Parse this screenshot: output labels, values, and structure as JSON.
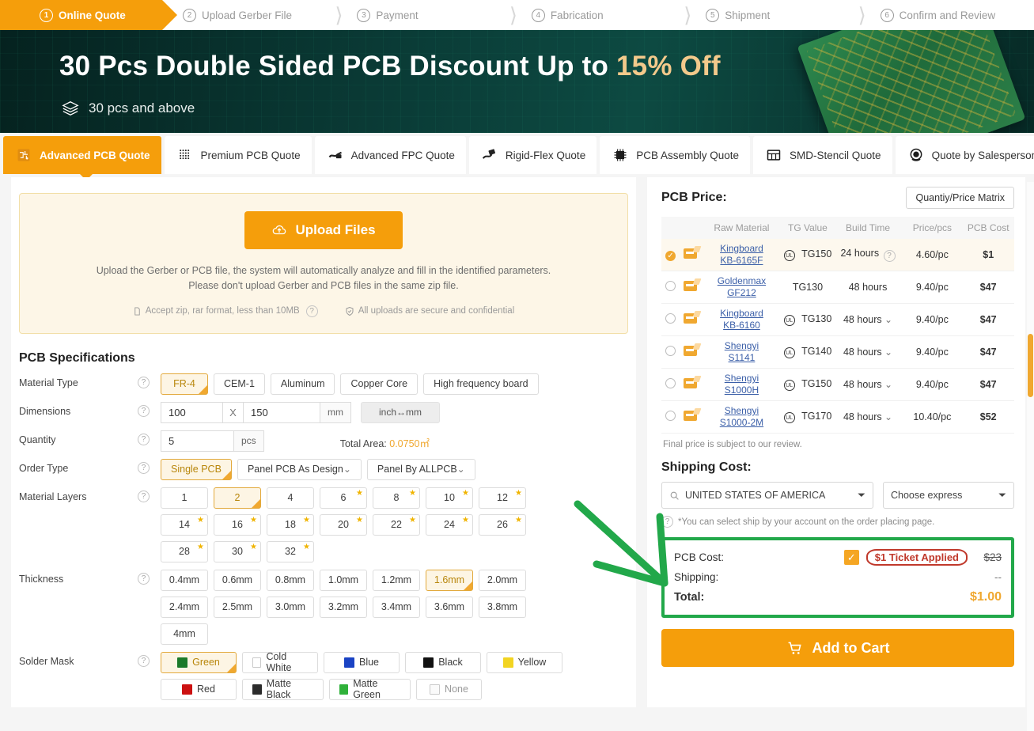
{
  "steps": [
    {
      "num": "1",
      "label": "Online Quote",
      "active": true
    },
    {
      "num": "2",
      "label": "Upload Gerber File",
      "active": false
    },
    {
      "num": "3",
      "label": "Payment",
      "active": false
    },
    {
      "num": "4",
      "label": "Fabrication",
      "active": false
    },
    {
      "num": "5",
      "label": "Shipment",
      "active": false
    },
    {
      "num": "6",
      "label": "Confirm and Review",
      "active": false
    }
  ],
  "banner": {
    "title_main": "30 Pcs Double Sided PCB Discount Up to ",
    "title_highlight": "15% Off",
    "subtitle": "30 pcs and above",
    "accent_color": "#f3c98b"
  },
  "tabs": [
    {
      "label": "Advanced PCB Quote",
      "icon": "pcb-chip-icon",
      "active": true
    },
    {
      "label": "Premium PCB Quote",
      "icon": "dot-grid-icon",
      "active": false
    },
    {
      "label": "Advanced FPC Quote",
      "icon": "flex-pcb-icon",
      "active": false
    },
    {
      "label": "Rigid-Flex Quote",
      "icon": "rigid-flex-icon",
      "active": false
    },
    {
      "label": "PCB Assembly Quote",
      "icon": "ic-chip-icon",
      "active": false
    },
    {
      "label": "SMD-Stencil Quote",
      "icon": "stencil-icon",
      "active": false
    },
    {
      "label": "Quote by Salesperson",
      "icon": "headset-icon",
      "active": false
    }
  ],
  "upload": {
    "button_label": "Upload Files",
    "desc_line1": "Upload the Gerber or PCB file, the system will automatically analyze and fill in the identified parameters.",
    "desc_line2": "Please don't upload Gerber and PCB files in the same zip file.",
    "meta_format": "Accept zip, rar format, less than 10MB",
    "meta_secure": "All uploads are secure and confidential"
  },
  "spec": {
    "title": "PCB Specifications",
    "material_type": {
      "label": "Material Type",
      "options": [
        "FR-4",
        "CEM-1",
        "Aluminum",
        "Copper Core",
        "High frequency board"
      ],
      "selected": "FR-4"
    },
    "dimensions": {
      "label": "Dimensions",
      "width": "100",
      "x": "X",
      "height": "150",
      "unit": "mm",
      "swap_label": "inch↔mm"
    },
    "quantity": {
      "label": "Quantity",
      "value": "5",
      "unit": "pcs",
      "total_area_label": "Total Area:",
      "total_area_value": "0.0750㎡"
    },
    "order_type": {
      "label": "Order Type",
      "options": [
        "Single PCB",
        "Panel PCB As Design",
        "Panel By ALLPCB"
      ],
      "dropdowns": [
        "Panel PCB As Design",
        "Panel By ALLPCB"
      ],
      "selected": "Single PCB"
    },
    "material_layers": {
      "label": "Material Layers",
      "options": [
        {
          "v": "1",
          "star": false
        },
        {
          "v": "2",
          "star": false
        },
        {
          "v": "4",
          "star": false
        },
        {
          "v": "6",
          "star": true
        },
        {
          "v": "8",
          "star": true
        },
        {
          "v": "10",
          "star": true
        },
        {
          "v": "12",
          "star": true
        },
        {
          "v": "14",
          "star": true
        },
        {
          "v": "16",
          "star": true
        },
        {
          "v": "18",
          "star": true
        },
        {
          "v": "20",
          "star": true
        },
        {
          "v": "22",
          "star": true
        },
        {
          "v": "24",
          "star": true
        },
        {
          "v": "26",
          "star": true
        },
        {
          "v": "28",
          "star": true
        },
        {
          "v": "30",
          "star": true
        },
        {
          "v": "32",
          "star": true
        }
      ],
      "selected": "2"
    },
    "thickness": {
      "label": "Thickness",
      "options": [
        "0.4mm",
        "0.6mm",
        "0.8mm",
        "1.0mm",
        "1.2mm",
        "1.6mm",
        "2.0mm",
        "2.4mm",
        "2.5mm",
        "3.0mm",
        "3.2mm",
        "3.4mm",
        "3.6mm",
        "3.8mm",
        "4mm"
      ],
      "selected": "1.6mm"
    },
    "solder_mask": {
      "label": "Solder Mask",
      "options": [
        {
          "name": "Green",
          "color": "#1b7a2a"
        },
        {
          "name": "Cold White",
          "color": "#ffffff"
        },
        {
          "name": "Blue",
          "color": "#1a43c4"
        },
        {
          "name": "Black",
          "color": "#111111"
        },
        {
          "name": "Yellow",
          "color": "#f2d422"
        },
        {
          "name": "Red",
          "color": "#cc1111"
        },
        {
          "name": "Matte Black",
          "color": "#2b2b2b"
        },
        {
          "name": "Matte Green",
          "color": "#2fb13a"
        },
        {
          "name": "None",
          "color": "none"
        }
      ],
      "selected": "Green"
    }
  },
  "price_panel": {
    "title": "PCB Price:",
    "matrix_button": "Quantiy/Price Matrix",
    "columns": [
      "",
      "",
      "Raw Material",
      "TG Value",
      "Build Time",
      "Price/pcs",
      "PCB Cost"
    ],
    "rows": [
      {
        "selected": true,
        "material_line1": "Kingboard",
        "material_line2": "KB-6165F",
        "ul": true,
        "tg": "TG150",
        "build_time": "24 hours",
        "build_help": true,
        "build_dropdown": false,
        "price": "4.60/pc",
        "cost": "$1"
      },
      {
        "selected": false,
        "material_line1": "Goldenmax",
        "material_line2": "GF212",
        "ul": false,
        "tg": "TG130",
        "build_time": "48 hours",
        "build_help": false,
        "build_dropdown": false,
        "price": "9.40/pc",
        "cost": "$47"
      },
      {
        "selected": false,
        "material_line1": "Kingboard",
        "material_line2": "KB-6160",
        "ul": true,
        "tg": "TG130",
        "build_time": "48 hours",
        "build_help": false,
        "build_dropdown": true,
        "price": "9.40/pc",
        "cost": "$47"
      },
      {
        "selected": false,
        "material_line1": "Shengyi",
        "material_line2": "S1141",
        "ul": true,
        "tg": "TG140",
        "build_time": "48 hours",
        "build_help": false,
        "build_dropdown": true,
        "price": "9.40/pc",
        "cost": "$47"
      },
      {
        "selected": false,
        "material_line1": "Shengyi",
        "material_line2": "S1000H",
        "ul": true,
        "tg": "TG150",
        "build_time": "48 hours",
        "build_help": false,
        "build_dropdown": true,
        "price": "9.40/pc",
        "cost": "$47"
      },
      {
        "selected": false,
        "material_line1": "Shengyi",
        "material_line2": "S1000-2M",
        "ul": true,
        "tg": "TG170",
        "build_time": "48 hours",
        "build_help": false,
        "build_dropdown": true,
        "price": "10.40/pc",
        "cost": "$52"
      }
    ],
    "final_note": "Final price is subject to our review."
  },
  "shipping": {
    "title": "Shipping Cost:",
    "country": "UNITED STATES OF AMERICA",
    "express_placeholder": "Choose express",
    "hint": "*You can select ship by your account on the order placing page."
  },
  "summary": {
    "pcb_cost_label": "PCB Cost:",
    "ticket_label": "$1 Ticket Applied",
    "pcb_cost_value": "$23",
    "shipping_label": "Shipping:",
    "shipping_value": "--",
    "total_label": "Total:",
    "total_value": "$1.00",
    "highlight_color": "#22a84a",
    "ticket_color": "#c0392b"
  },
  "cart": {
    "label": "Add to Cart"
  }
}
